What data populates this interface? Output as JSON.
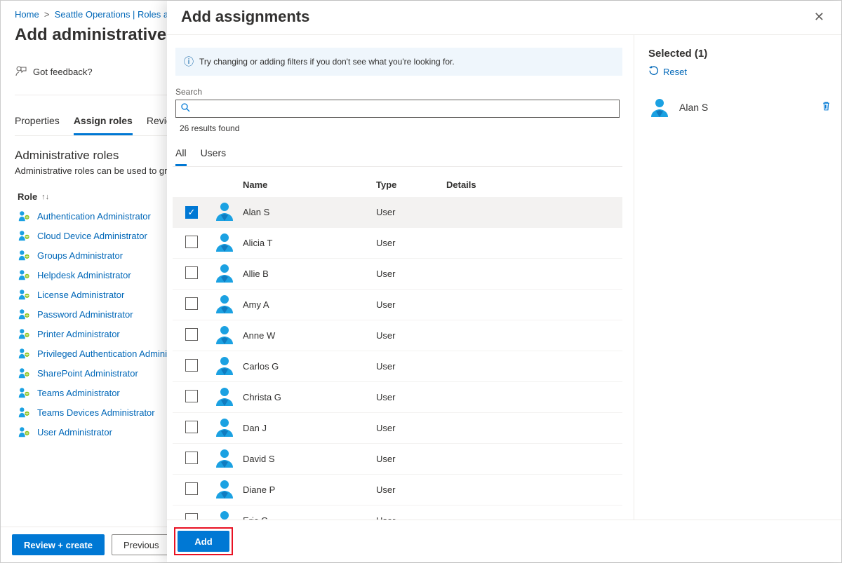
{
  "breadcrumb": {
    "home": "Home",
    "second": "Seattle Operations | Roles and"
  },
  "page_title": "Add administrative uni",
  "feedback": "Got feedback?",
  "bg_tabs": {
    "properties": "Properties",
    "assign_roles": "Assign roles",
    "review": "Review"
  },
  "section": {
    "title": "Administrative roles",
    "sub": "Administrative roles can be used to grant"
  },
  "role_header": "Role",
  "roles": [
    "Authentication Administrator",
    "Cloud Device Administrator",
    "Groups Administrator",
    "Helpdesk Administrator",
    "License Administrator",
    "Password Administrator",
    "Printer Administrator",
    "Privileged Authentication Administ",
    "SharePoint Administrator",
    "Teams Administrator",
    "Teams Devices Administrator",
    "User Administrator"
  ],
  "footer": {
    "review_create": "Review + create",
    "previous": "Previous"
  },
  "flyout": {
    "title": "Add assignments",
    "info": "Try changing or adding filters if you don't see what you're looking for.",
    "search_label": "Search",
    "results": "26 results found",
    "tabs": {
      "all": "All",
      "users": "Users"
    },
    "columns": {
      "name": "Name",
      "type": "Type",
      "details": "Details"
    },
    "people": [
      {
        "name": "Alan S",
        "type": "User",
        "selected": true
      },
      {
        "name": "Alicia T",
        "type": "User",
        "selected": false
      },
      {
        "name": "Allie B",
        "type": "User",
        "selected": false
      },
      {
        "name": "Amy A",
        "type": "User",
        "selected": false
      },
      {
        "name": "Anne W",
        "type": "User",
        "selected": false
      },
      {
        "name": "Carlos G",
        "type": "User",
        "selected": false
      },
      {
        "name": "Christa G",
        "type": "User",
        "selected": false
      },
      {
        "name": "Dan J",
        "type": "User",
        "selected": false
      },
      {
        "name": "David S",
        "type": "User",
        "selected": false
      },
      {
        "name": "Diane P",
        "type": "User",
        "selected": false
      },
      {
        "name": "Eric G",
        "type": "User",
        "selected": false
      }
    ],
    "selected_title": "Selected (1)",
    "reset": "Reset",
    "selected_item": "Alan S",
    "add_button": "Add"
  }
}
